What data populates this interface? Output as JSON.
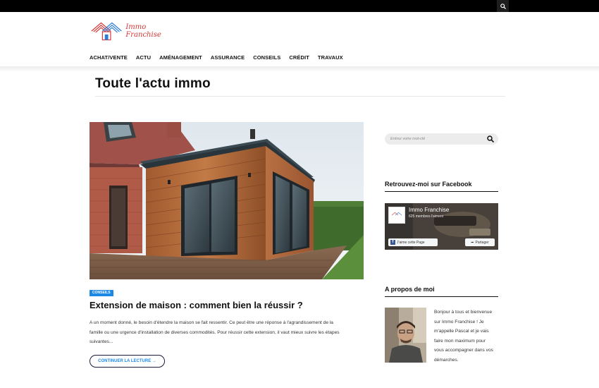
{
  "topbar": {
    "search_icon": "search-icon"
  },
  "brand": {
    "name": "Immo Franchise",
    "colors": {
      "red": "#d63535",
      "blue": "#2b7bd6"
    }
  },
  "nav": {
    "items": [
      "ACHAT/VENTE",
      "ACTU",
      "AMÉNAGEMENT",
      "ASSURANCE",
      "CONSEILS",
      "CRÉDIT",
      "TRAVAUX"
    ]
  },
  "page": {
    "title": "Toute l'actu immo"
  },
  "post": {
    "category": "CONSEILS",
    "title": "Extension de maison : comment bien la réussir ?",
    "excerpt_lines": [
      "A un moment donné, le besoin d'étendre la maison se fait ressentir. Ce peut être une réponse à l'agrandissement de la",
      "famille ou une urgence d'installation de diverses commodités. Pour réussir cette extension, il vaut mieux suivre les étapes",
      "suivantes..."
    ],
    "read_more": "CONTINUER LA LECTURE →"
  },
  "sidebar": {
    "search": {
      "placeholder": "Entrez votre mot-clé"
    },
    "facebook": {
      "title": "Retrouvez-moi sur Facebook",
      "page_name": "Immo Franchise",
      "members": "625 membres l'aiment",
      "like_label": "J'aime cette Page",
      "share_label": "Partager"
    },
    "about": {
      "title": "A propos de moi",
      "lines": [
        "Bonjour à tous et bienvenue",
        "sur Immo Franchise ! Je",
        "m'appelle Pascal et je vais",
        "faire mon maximum pour",
        "vous accompagner dans vos",
        "démarches."
      ]
    }
  },
  "colors": {
    "accent": "#1e88e5",
    "topbar": "#000000",
    "text": "#111111"
  }
}
